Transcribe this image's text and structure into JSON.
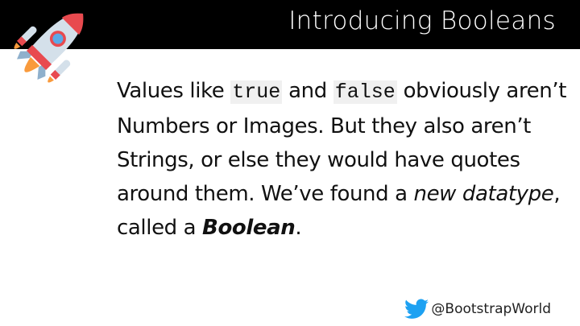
{
  "header": {
    "title": "Introducing Booleans"
  },
  "body": {
    "t1": "Values like ",
    "code_true": "true",
    "t2": " and ",
    "code_false": "false",
    "t3": " obviously aren’t Numbers or Images. But they also aren’t Strings, or else they would have quotes around them. We’ve found a ",
    "em": "new datatype",
    "t4": ", called a ",
    "strong": "Boolean",
    "t5": "."
  },
  "footer": {
    "handle": "@BootstrapWorld",
    "icon": "twitter-bird-icon",
    "icon_color": "#1da1f2"
  },
  "icons": {
    "rocket": "rocket-icon"
  }
}
